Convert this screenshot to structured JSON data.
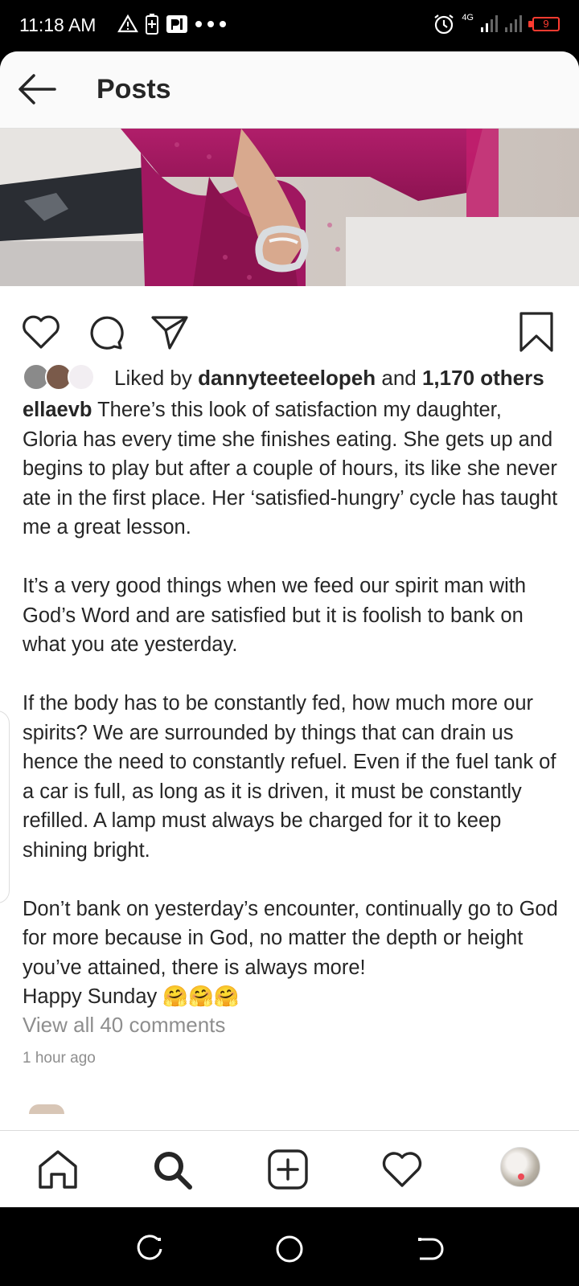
{
  "status_bar": {
    "time": "11:18 AM",
    "network": "4G",
    "battery": "9",
    "icons_left": [
      "alert-icon",
      "battery-saver-icon",
      "p-icon",
      "more-dots-icon"
    ],
    "icons_right": [
      "alarm-icon",
      "signal-icon",
      "signal-icon",
      "battery-icon"
    ]
  },
  "header": {
    "title": "Posts"
  },
  "actions": {
    "icons": [
      "heart-icon",
      "comment-icon",
      "share-icon",
      "bookmark-icon"
    ]
  },
  "likes": {
    "prefix": "Liked by ",
    "user": "dannyteeteelopeh",
    "middle": " and ",
    "others": "1,170 others"
  },
  "caption": {
    "username": "ellaevb",
    "p1_rest": " There’s this look of satisfaction my daughter, Gloria has every time she finishes eating. She gets up and begins to play but after a couple of hours, its like she never ate in the first place. Her ‘satisfied-hungry’ cycle has taught me a great lesson.",
    "p2": "It’s a very good things when we feed our spirit man with God’s Word and are satisfied but it is foolish to bank on what you ate yesterday.",
    "p3": "If the body has to be constantly fed, how much more our spirits? We are surrounded by things that can drain us hence the need to constantly refuel. Even if the fuel tank of a car is full, as long as it is driven, it must be constantly refilled. A lamp must always be charged for it to keep shining bright.",
    "p4": "Don’t bank on yesterday’s encounter, continually go to God for more because in God, no matter the depth or height you’ve attained, there is always more!",
    "p5": "Happy Sunday 🤗🤗🤗"
  },
  "view_comments": "View all 40 comments",
  "time_ago": "1 hour ago",
  "bottom_nav": [
    "home-icon",
    "search-icon",
    "new-post-icon",
    "activity-heart-icon",
    "profile-avatar"
  ],
  "system_nav": [
    "recent-apps-icon",
    "home-circle-icon",
    "back-icon"
  ],
  "colors": {
    "text": "#262626",
    "muted": "#8e8e8e",
    "notification_dot": "#ed4956",
    "battery_low": "#ff3b30",
    "dress_magenta": "#a0175f"
  }
}
